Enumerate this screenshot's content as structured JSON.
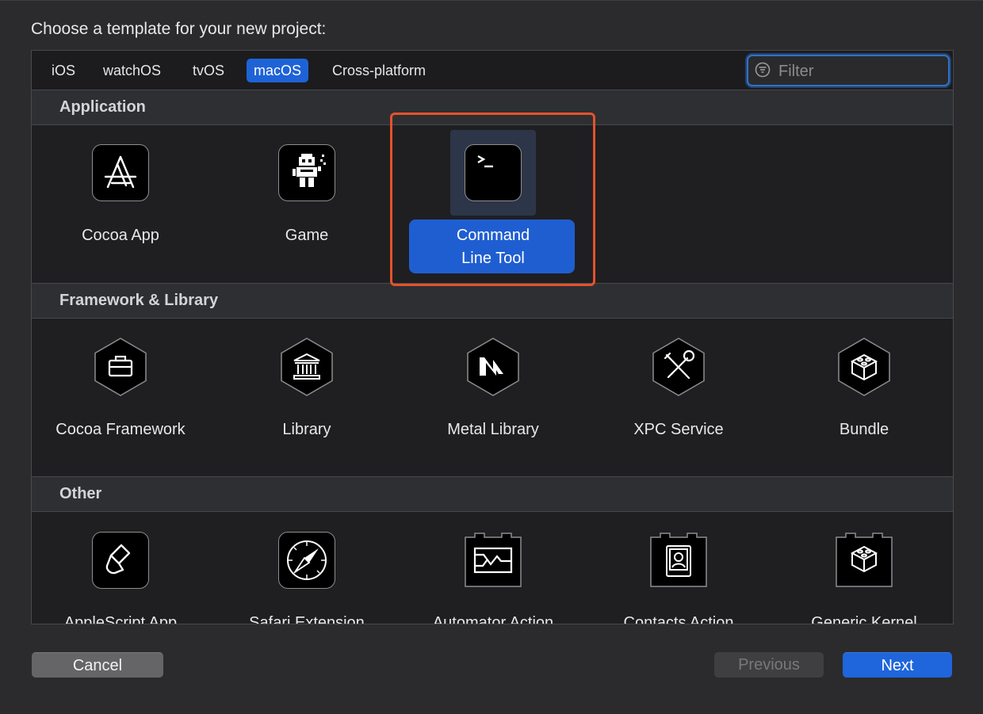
{
  "prompt": "Choose a template for your new project:",
  "tabs": [
    {
      "label": "iOS"
    },
    {
      "label": "watchOS"
    },
    {
      "label": "tvOS"
    },
    {
      "label": "macOS",
      "active": true
    },
    {
      "label": "Cross-platform"
    }
  ],
  "filter": {
    "placeholder": "Filter",
    "value": ""
  },
  "sections": [
    {
      "title": "Application",
      "items": [
        {
          "label": "Cocoa App",
          "icon": "app-store-a-icon"
        },
        {
          "label": "Game",
          "icon": "game-robot-icon"
        },
        {
          "label": "Command Line Tool",
          "icon": "terminal-icon",
          "selected": true
        }
      ]
    },
    {
      "title": "Framework & Library",
      "items": [
        {
          "label": "Cocoa Framework",
          "icon": "toolbox-icon"
        },
        {
          "label": "Library",
          "icon": "library-building-icon"
        },
        {
          "label": "Metal Library",
          "icon": "metal-icon"
        },
        {
          "label": "XPC Service",
          "icon": "tools-icon"
        },
        {
          "label": "Bundle",
          "icon": "cube-icon"
        }
      ]
    },
    {
      "title": "Other",
      "items": [
        {
          "label": "AppleScript App",
          "icon": "applescript-icon"
        },
        {
          "label": "Safari Extension",
          "icon": "compass-icon"
        },
        {
          "label": "Automator Action",
          "icon": "automator-icon"
        },
        {
          "label": "Contacts Action",
          "icon": "contacts-icon"
        },
        {
          "label": "Generic Kernel",
          "icon": "kernel-cube-icon"
        }
      ]
    }
  ],
  "buttons": {
    "cancel": "Cancel",
    "previous": "Previous",
    "next": "Next"
  },
  "colors": {
    "accent": "#1f65dc",
    "highlight_border": "#e5522d",
    "panel": "#1f1f21"
  }
}
